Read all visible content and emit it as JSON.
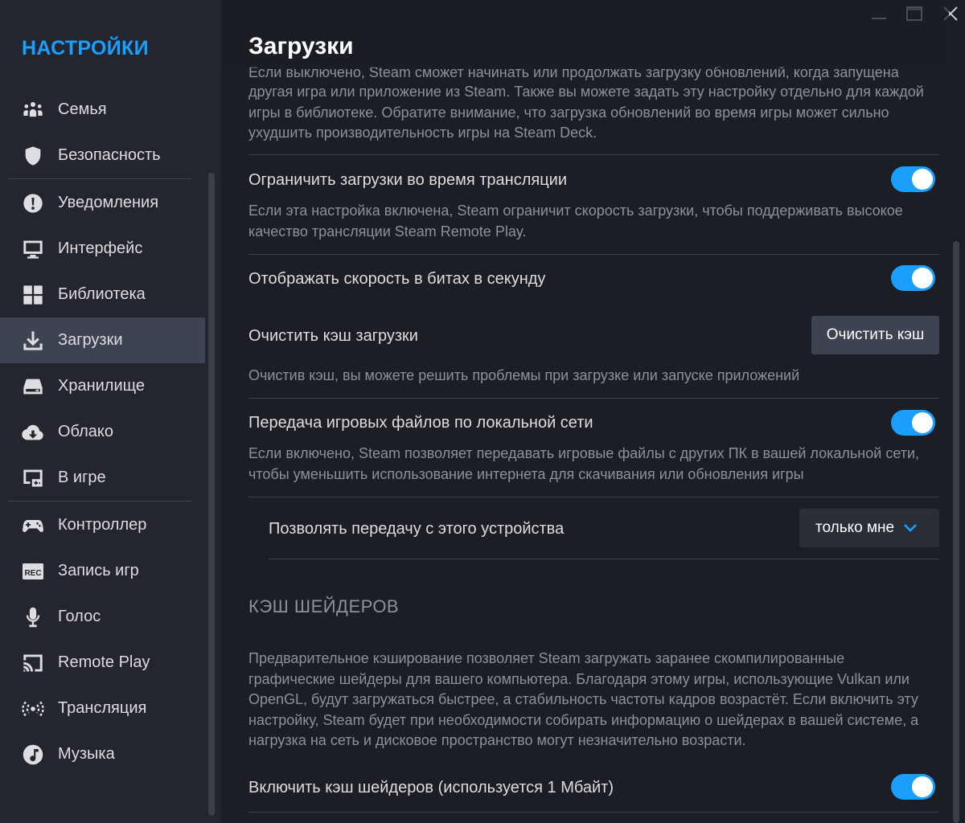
{
  "sidebar": {
    "title": "НАСТРОЙКИ",
    "items": [
      {
        "label": "Семья",
        "icon": "family-icon"
      },
      {
        "label": "Безопасность",
        "icon": "shield-icon"
      },
      {
        "label": "Уведомления",
        "icon": "alert-icon"
      },
      {
        "label": "Интерфейс",
        "icon": "monitor-icon"
      },
      {
        "label": "Библиотека",
        "icon": "grid-icon"
      },
      {
        "label": "Загрузки",
        "icon": "download-icon",
        "active": true
      },
      {
        "label": "Хранилище",
        "icon": "drive-icon"
      },
      {
        "label": "Облако",
        "icon": "cloud-icon"
      },
      {
        "label": "В игре",
        "icon": "ingame-icon"
      },
      {
        "label": "Контроллер",
        "icon": "controller-icon"
      },
      {
        "label": "Запись игр",
        "icon": "rec-icon"
      },
      {
        "label": "Голос",
        "icon": "microphone-icon"
      },
      {
        "label": "Remote Play",
        "icon": "cast-icon"
      },
      {
        "label": "Трансляция",
        "icon": "broadcast-icon"
      },
      {
        "label": "Музыка",
        "icon": "music-icon"
      }
    ]
  },
  "window": {
    "minimize_icon": "minimize-icon",
    "maximize_icon": "maximize-icon",
    "close_icon": "close-icon"
  },
  "main": {
    "title": "Загрузки",
    "intro_desc": "Если выключено, Steam сможет начинать или продолжать загрузку обновлений, когда запущена другая игра или приложение из Steam. Также вы можете задать эту настройку отдельно для каждой игры в библиотеке. Обратите внимание, что загрузка обновлений во время игры может сильно ухудшить производительность игры на Steam Deck.",
    "intro_desc_visible": "другая игра или приложение из Steam. Также вы можете задать эту настройку отдельно для каждой игры в библиотеке. Обратите внимание, что загрузка обновлений во время игры может сильно ухудшить производительность игры на Steam Deck.",
    "intro_desc_top_line": "Если выключено, Steam сможет начинать или продолжать загрузку обновлений, когда запущена",
    "limit_streaming": {
      "label": "Ограничить загрузки во время трансляции",
      "desc": "Если эта настройка включена, Steam ограничит скорость загрузки, чтобы поддерживать высокое качество трансляции Steam Remote Play.",
      "enabled": true
    },
    "bits_per_second": {
      "label": "Отображать скорость в битах в секунду",
      "enabled": true
    },
    "clear_cache": {
      "label": "Очистить кэш загрузки",
      "button": "Очистить кэш",
      "desc": "Очистив кэш, вы можете решить проблемы при загрузке или запуске приложений"
    },
    "lan_transfer": {
      "label": "Передача игровых файлов по локальной сети",
      "desc": "Если включено, Steam позволяет передавать игровые файлы с других ПК в вашей локальной сети, чтобы уменьшить использование интернета для скачивания или обновления игры",
      "enabled": true
    },
    "allow_transfer": {
      "label": "Позволять передачу с этого устройства",
      "selected": "только мне"
    },
    "shader_section": {
      "heading": "КЭШ ШЕЙДЕРОВ",
      "desc": "Предварительное кэширование позволяет Steam загружать заранее скомпилированные графические шейдеры для вашего компьютера. Благодаря этому игры, использующие Vulkan или OpenGL, будут загружаться быстрее, а стабильность частоты кадров возрастёт. Если включить эту настройку, Steam будет при необходимости собирать информацию о шейдерах в вашей системе, а нагрузка на сеть и дисковое пространство могут незначительно возрасти.",
      "enable_label": "Включить кэш шейдеров (используется 1 Мбайт)",
      "enabled": true
    }
  },
  "colors": {
    "accent": "#1a9fff",
    "background": "#1b1e24",
    "sidebar": "#23262e",
    "active_item": "#3d4350"
  }
}
